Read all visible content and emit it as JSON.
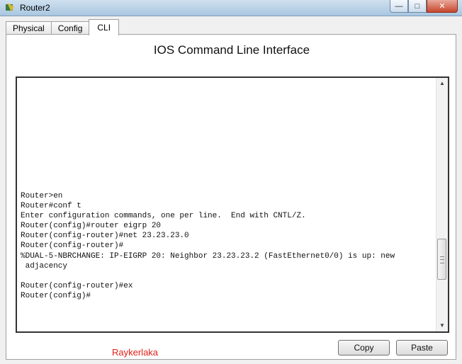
{
  "window": {
    "title": "Router2"
  },
  "tabs": [
    {
      "label": "Physical"
    },
    {
      "label": "Config"
    },
    {
      "label": "CLI"
    }
  ],
  "panel": {
    "title": "IOS Command Line Interface"
  },
  "terminal": {
    "lines": [
      "Router>en",
      "Router#conf t",
      "Enter configuration commands, one per line.  End with CNTL/Z.",
      "Router(config)#router eigrp 20",
      "Router(config-router)#net 23.23.23.0",
      "Router(config-router)#",
      "%DUAL-5-NBRCHANGE: IP-EIGRP 20: Neighbor 23.23.23.2 (FastEthernet0/0) is up: new",
      " adjacency",
      "",
      "Router(config-router)#ex",
      "Router(config)#"
    ]
  },
  "watermark": "Raykerlaka",
  "buttons": {
    "copy": "Copy",
    "paste": "Paste"
  },
  "colors": {
    "watermark": "#e0201a",
    "terminal_border": "#333333"
  }
}
